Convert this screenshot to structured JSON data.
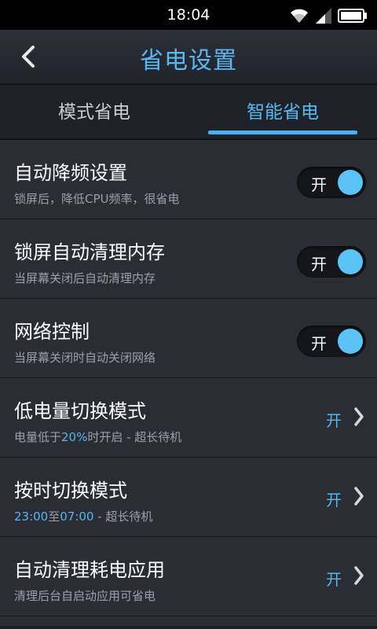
{
  "status": {
    "time": "18:04"
  },
  "header": {
    "title": "省电设置"
  },
  "tabs": [
    {
      "label": "模式省电",
      "selected": false
    },
    {
      "label": "智能省电",
      "selected": true
    }
  ],
  "rows": [
    {
      "title": "自动降频设置",
      "subtitle": "锁屏后，降低CPU频率，很省电",
      "toggle": "开"
    },
    {
      "title": "锁屏自动清理内存",
      "subtitle": "当屏幕关闭后自动清理内存",
      "toggle": "开"
    },
    {
      "title": "网络控制",
      "subtitle": "当屏幕关闭时自动关闭网络",
      "toggle": "开"
    },
    {
      "title": "低电量切换模式",
      "subtitle_pre": "电量低于",
      "subtitle_hl": "20%",
      "subtitle_post": "时开启 - 超长待机",
      "state": "开"
    },
    {
      "title": "按时切换模式",
      "subtitle_hl1": "23:00",
      "subtitle_mid": "至",
      "subtitle_hl2": "07:00",
      "subtitle_post": " - 超长待机",
      "state": "开"
    },
    {
      "title": "自动清理耗电应用",
      "subtitle": "清理后台自启动应用可省电",
      "state": "开"
    }
  ],
  "colors": {
    "accent": "#5ab8ef",
    "toggle_knob": "#5cc3f6",
    "row_bg": "#2a2d33"
  }
}
